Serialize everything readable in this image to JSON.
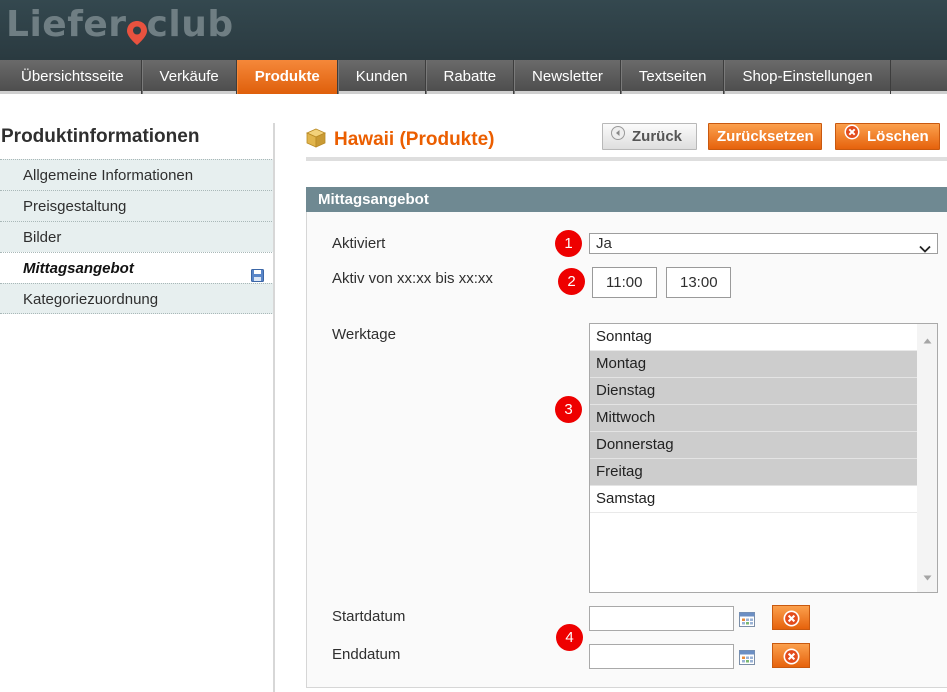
{
  "logo": {
    "left": "Liefer",
    "right": "club"
  },
  "nav": {
    "items": [
      {
        "label": "Übersichtsseite"
      },
      {
        "label": "Verkäufe"
      },
      {
        "label": "Produkte"
      },
      {
        "label": "Kunden"
      },
      {
        "label": "Rabatte"
      },
      {
        "label": "Newsletter"
      },
      {
        "label": "Textseiten"
      },
      {
        "label": "Shop-Einstellungen"
      }
    ],
    "active": "Produkte"
  },
  "sidebar": {
    "title": "Produktinformationen",
    "items": [
      {
        "label": "Allgemeine Informationen"
      },
      {
        "label": "Preisgestaltung"
      },
      {
        "label": "Bilder"
      },
      {
        "label": "Mittagsangebot"
      },
      {
        "label": "Kategoriezuordnung"
      }
    ],
    "active": "Mittagsangebot"
  },
  "page": {
    "title": "Hawaii (Produkte)",
    "buttons": {
      "back": "Zurück",
      "reset": "Zurücksetzen",
      "delete": "Löschen"
    }
  },
  "fieldset": {
    "title": "Mittagsangebot",
    "enabled": {
      "label": "Aktiviert",
      "value": "Ja"
    },
    "active_time": {
      "label": "Aktiv von xx:xx bis xx:xx",
      "from": "11:00",
      "to": "13:00"
    },
    "weekdays": {
      "label": "Werktage",
      "options": [
        {
          "label": "Sonntag",
          "selected": false
        },
        {
          "label": "Montag",
          "selected": true
        },
        {
          "label": "Dienstag",
          "selected": true
        },
        {
          "label": "Mittwoch",
          "selected": true
        },
        {
          "label": "Donnerstag",
          "selected": true
        },
        {
          "label": "Freitag",
          "selected": true
        },
        {
          "label": "Samstag",
          "selected": false
        }
      ]
    },
    "start_date": {
      "label": "Startdatum",
      "value": ""
    },
    "end_date": {
      "label": "Enddatum",
      "value": ""
    }
  },
  "annotations": [
    "1",
    "2",
    "3",
    "4"
  ],
  "colors": {
    "accent": "#eb5e00",
    "badge": "#ee0000",
    "fieldset_header": "#6f8992"
  }
}
